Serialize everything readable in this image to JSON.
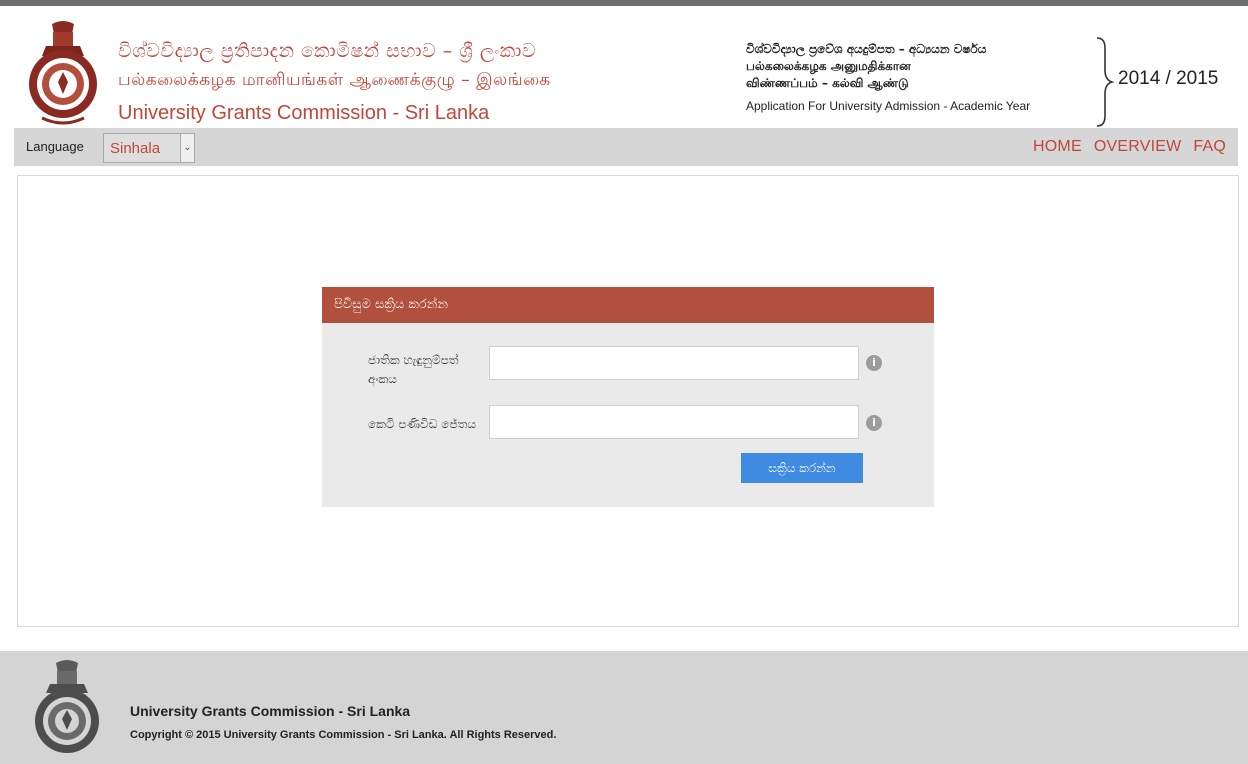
{
  "header": {
    "org_name_sinhala": "විශ්වවිද්‍යාල ප්‍රතිපාදන කොමිෂන් සභාව – ශ්‍රී ලංකාව",
    "org_name_tamil": "பல்கலைக்கழக மானியங்கள் ஆணைக்குழு – இலங்கை",
    "org_name_english": "University Grants Commission - Sri Lanka",
    "app_title_sinhala": "විශ්වවිද්‍යාල ප්‍රවේශ අයදුම්පත – අධ්‍යයන වර්ෂය",
    "app_title_tamil_line1": "பல்கலைக்கழக அனுமதிக்கான",
    "app_title_tamil_line2": "விண்ணப்பம் – கல்வி ஆண்டு",
    "app_title_english": "Application For University Admission - Academic Year",
    "academic_year": "2014 / 2015"
  },
  "navbar": {
    "language_label": "Language",
    "language_selected": "Sinhala",
    "links": [
      "HOME",
      "OVERVIEW",
      "FAQ"
    ]
  },
  "login": {
    "title": "පිවිසුම සක්‍රිය කරන්න",
    "nic_label": "ජාතික හැඳුනුම්පත් අංකය",
    "index_label": "කෙටි පණිවිඩ ජේතය",
    "nic_value": "",
    "index_value": "",
    "info_icon": "info-icon",
    "submit_label": "සක්‍රිය කරන්න"
  },
  "footer": {
    "title": "University Grants Commission - Sri Lanka",
    "copyright": "Copyright © 2015 University Grants Commission - Sri Lanka. All Rights Reserved."
  },
  "colors": {
    "brand_red": "#c0473a",
    "card_header": "#b2503e",
    "button_blue": "#3f8be2",
    "nav_bg": "#d6d6d6",
    "footer_bg": "#d4d4d4"
  }
}
